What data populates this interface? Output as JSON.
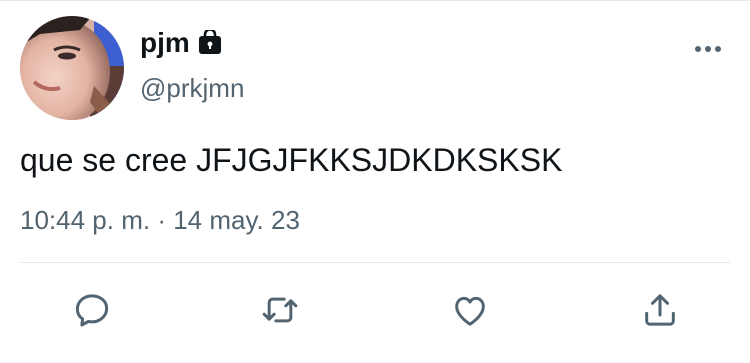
{
  "user": {
    "display_name": "pjm",
    "handle": "@prkjmn",
    "protected_icon": "lock-icon",
    "avatar": "profile-photo"
  },
  "tweet": {
    "text": "que se cree JFJGJFKKSJDKDKSKSK",
    "time": "10:44 p. m.",
    "separator": "·",
    "date": "14 may. 23"
  },
  "actions": {
    "reply_icon": "reply-icon",
    "retweet_icon": "retweet-icon",
    "like_icon": "heart-icon",
    "share_icon": "share-icon",
    "more_icon": "more-icon"
  },
  "colors": {
    "primary_text": "#0f1419",
    "secondary_text": "#536471",
    "icon": "#536471",
    "divider": "#e7e9ea"
  }
}
